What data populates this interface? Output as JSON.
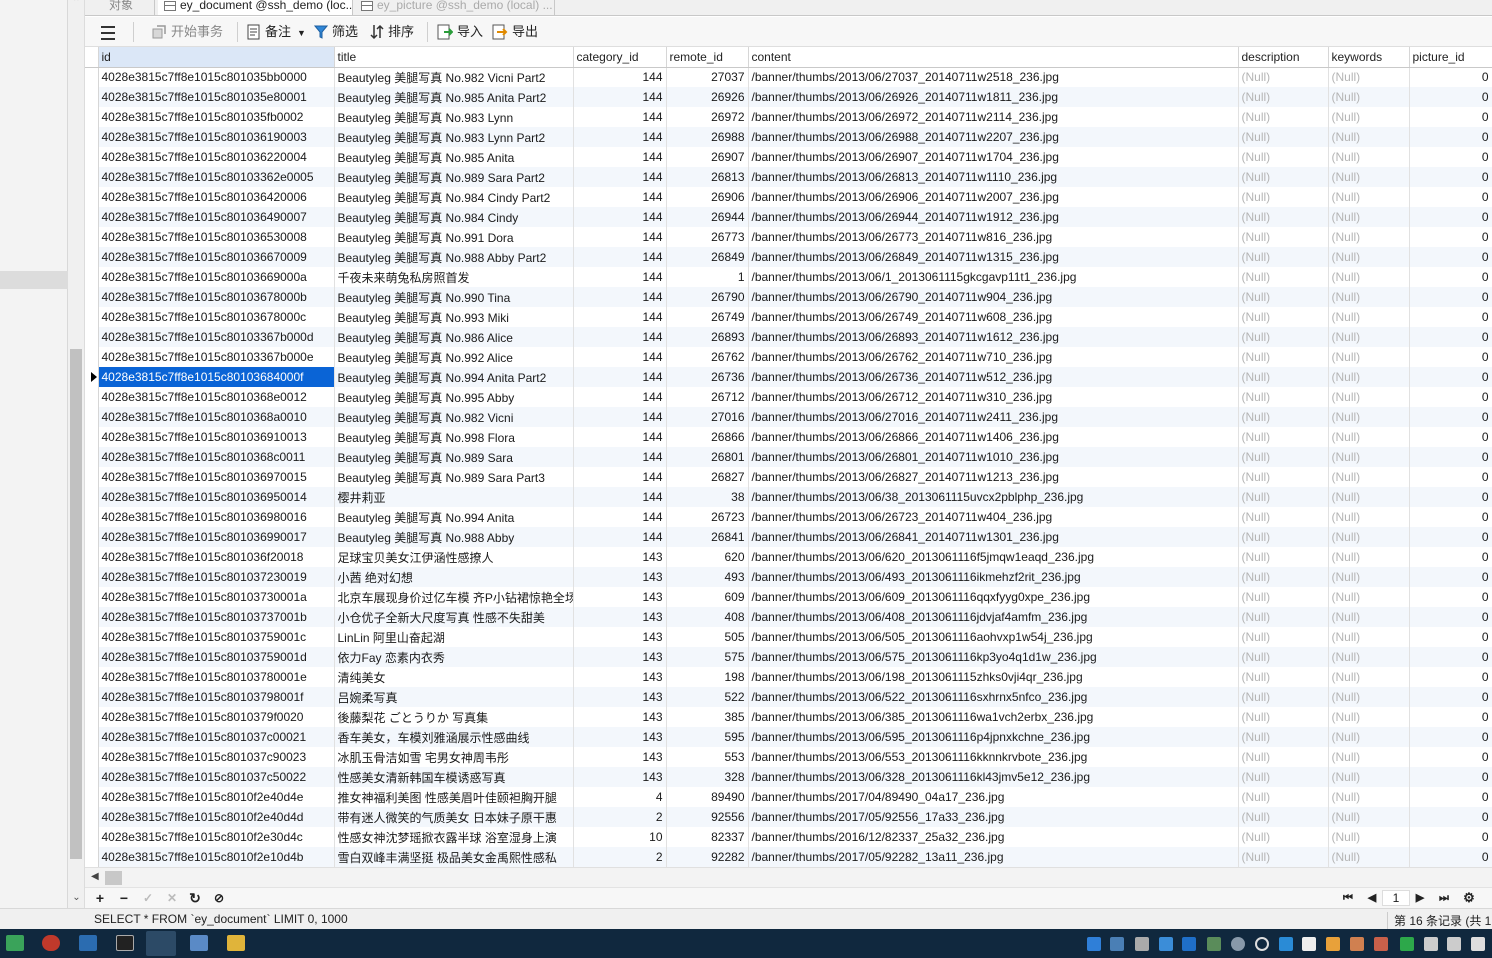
{
  "tabs": [
    {
      "label": "对象"
    },
    {
      "label": "ey_document @ssh_demo (loc..."
    },
    {
      "label": "ey_picture @ssh_demo (local) ..."
    }
  ],
  "toolbar": {
    "begin_transaction": "开始事务",
    "note": "备注",
    "filter": "筛选",
    "sort": "排序",
    "import": "导入",
    "export": "导出"
  },
  "columns": [
    "id",
    "title",
    "category_id",
    "remote_id",
    "content",
    "description",
    "keywords",
    "picture_id"
  ],
  "null_text": "(Null)",
  "current_row_index": 15,
  "rows": [
    {
      "id": "4028e3815c7ff8e1015c801035bb0000",
      "title": "Beautyleg 美腿写真 No.982 Vicni Part2",
      "category_id": "144",
      "remote_id": "27037",
      "content": "/banner/thumbs/2013/06/27037_20140711w2518_236.jpg",
      "picture_id": "0"
    },
    {
      "id": "4028e3815c7ff8e1015c801035e80001",
      "title": "Beautyleg 美腿写真 No.985 Anita Part2",
      "category_id": "144",
      "remote_id": "26926",
      "content": "/banner/thumbs/2013/06/26926_20140711w1811_236.jpg",
      "picture_id": "0"
    },
    {
      "id": "4028e3815c7ff8e1015c801035fb0002",
      "title": "Beautyleg 美腿写真 No.983 Lynn",
      "category_id": "144",
      "remote_id": "26972",
      "content": "/banner/thumbs/2013/06/26972_20140711w2114_236.jpg",
      "picture_id": "0"
    },
    {
      "id": "4028e3815c7ff8e1015c801036190003",
      "title": "Beautyleg 美腿写真 No.983 Lynn Part2",
      "category_id": "144",
      "remote_id": "26988",
      "content": "/banner/thumbs/2013/06/26988_20140711w2207_236.jpg",
      "picture_id": "0"
    },
    {
      "id": "4028e3815c7ff8e1015c801036220004",
      "title": "Beautyleg 美腿写真 No.985 Anita",
      "category_id": "144",
      "remote_id": "26907",
      "content": "/banner/thumbs/2013/06/26907_20140711w1704_236.jpg",
      "picture_id": "0"
    },
    {
      "id": "4028e3815c7ff8e1015c80103362e0005",
      "title": "Beautyleg 美腿写真 No.989 Sara Part2",
      "category_id": "144",
      "remote_id": "26813",
      "content": "/banner/thumbs/2013/06/26813_20140711w1110_236.jpg",
      "picture_id": "0"
    },
    {
      "id": "4028e3815c7ff8e1015c801036420006",
      "title": "Beautyleg 美腿写真 No.984 Cindy Part2",
      "category_id": "144",
      "remote_id": "26906",
      "content": "/banner/thumbs/2013/06/26906_20140711w2007_236.jpg",
      "picture_id": "0"
    },
    {
      "id": "4028e3815c7ff8e1015c801036490007",
      "title": "Beautyleg 美腿写真 No.984 Cindy",
      "category_id": "144",
      "remote_id": "26944",
      "content": "/banner/thumbs/2013/06/26944_20140711w1912_236.jpg",
      "picture_id": "0"
    },
    {
      "id": "4028e3815c7ff8e1015c801036530008",
      "title": "Beautyleg 美腿写真 No.991 Dora",
      "category_id": "144",
      "remote_id": "26773",
      "content": "/banner/thumbs/2013/06/26773_20140711w816_236.jpg",
      "picture_id": "0"
    },
    {
      "id": "4028e3815c7ff8e1015c801036670009",
      "title": "Beautyleg 美腿写真 No.988 Abby Part2",
      "category_id": "144",
      "remote_id": "26849",
      "content": "/banner/thumbs/2013/06/26849_20140711w1315_236.jpg",
      "picture_id": "0"
    },
    {
      "id": "4028e3815c7ff8e1015c80103669000a",
      "title": "千夜未来萌兔私房照首发",
      "category_id": "144",
      "remote_id": "1",
      "content": "/banner/thumbs/2013/06/1_2013061115gkcgavp11t1_236.jpg",
      "picture_id": "0"
    },
    {
      "id": "4028e3815c7ff8e1015c80103678000b",
      "title": "Beautyleg 美腿写真 No.990 Tina",
      "category_id": "144",
      "remote_id": "26790",
      "content": "/banner/thumbs/2013/06/26790_20140711w904_236.jpg",
      "picture_id": "0"
    },
    {
      "id": "4028e3815c7ff8e1015c80103678000c",
      "title": "Beautyleg 美腿写真 No.993 Miki",
      "category_id": "144",
      "remote_id": "26749",
      "content": "/banner/thumbs/2013/06/26749_20140711w608_236.jpg",
      "picture_id": "0"
    },
    {
      "id": "4028e3815c7ff8e1015c80103367b000d",
      "title": "Beautyleg 美腿写真 No.986 Alice",
      "category_id": "144",
      "remote_id": "26893",
      "content": "/banner/thumbs/2013/06/26893_20140711w1612_236.jpg",
      "picture_id": "0"
    },
    {
      "id": "4028e3815c7ff8e1015c80103367b000e",
      "title": "Beautyleg 美腿写真 No.992 Alice",
      "category_id": "144",
      "remote_id": "26762",
      "content": "/banner/thumbs/2013/06/26762_20140711w710_236.jpg",
      "picture_id": "0"
    },
    {
      "id": "4028e3815c7ff8e1015c80103684000f",
      "title": "Beautyleg 美腿写真 No.994 Anita Part2",
      "category_id": "144",
      "remote_id": "26736",
      "content": "/banner/thumbs/2013/06/26736_20140711w512_236.jpg",
      "picture_id": "0"
    },
    {
      "id": "4028e3815c7ff8e1015c8010368e0012",
      "title": "Beautyleg 美腿写真 No.995 Abby",
      "category_id": "144",
      "remote_id": "26712",
      "content": "/banner/thumbs/2013/06/26712_20140711w310_236.jpg",
      "picture_id": "0"
    },
    {
      "id": "4028e3815c7ff8e1015c8010368a0010",
      "title": "Beautyleg 美腿写真 No.982 Vicni",
      "category_id": "144",
      "remote_id": "27016",
      "content": "/banner/thumbs/2013/06/27016_20140711w2411_236.jpg",
      "picture_id": "0"
    },
    {
      "id": "4028e3815c7ff8e1015c801036910013",
      "title": "Beautyleg 美腿写真 No.998 Flora",
      "category_id": "144",
      "remote_id": "26866",
      "content": "/banner/thumbs/2013/06/26866_20140711w1406_236.jpg",
      "picture_id": "0"
    },
    {
      "id": "4028e3815c7ff8e1015c8010368c0011",
      "title": "Beautyleg 美腿写真 No.989 Sara",
      "category_id": "144",
      "remote_id": "26801",
      "content": "/banner/thumbs/2013/06/26801_20140711w1010_236.jpg",
      "picture_id": "0"
    },
    {
      "id": "4028e3815c7ff8e1015c801036970015",
      "title": "Beautyleg 美腿写真 No.989 Sara Part3",
      "category_id": "144",
      "remote_id": "26827",
      "content": "/banner/thumbs/2013/06/26827_20140711w1213_236.jpg",
      "picture_id": "0"
    },
    {
      "id": "4028e3815c7ff8e1015c801036950014",
      "title": "樱井莉亚",
      "category_id": "144",
      "remote_id": "38",
      "content": "/banner/thumbs/2013/06/38_2013061115uvcx2pblphp_236.jpg",
      "picture_id": "0"
    },
    {
      "id": "4028e3815c7ff8e1015c801036980016",
      "title": "Beautyleg 美腿写真 No.994 Anita",
      "category_id": "144",
      "remote_id": "26723",
      "content": "/banner/thumbs/2013/06/26723_20140711w404_236.jpg",
      "picture_id": "0"
    },
    {
      "id": "4028e3815c7ff8e1015c801036990017",
      "title": "Beautyleg 美腿写真 No.988 Abby",
      "category_id": "144",
      "remote_id": "26841",
      "content": "/banner/thumbs/2013/06/26841_20140711w1301_236.jpg",
      "picture_id": "0"
    },
    {
      "id": "4028e3815c7ff8e1015c801036f20018",
      "title": "足球宝贝美女江伊涵性感撩人",
      "category_id": "143",
      "remote_id": "620",
      "content": "/banner/thumbs/2013/06/620_2013061116f5jmqw1eaqd_236.jpg",
      "picture_id": "0"
    },
    {
      "id": "4028e3815c7ff8e1015c801037230019",
      "title": "小茜 绝对幻想",
      "category_id": "143",
      "remote_id": "493",
      "content": "/banner/thumbs/2013/06/493_2013061116ikmehzf2rit_236.jpg",
      "picture_id": "0"
    },
    {
      "id": "4028e3815c7ff8e1015c80103730001a",
      "title": "北京车展现身价过亿车模 齐P小钻裙惊艳全场",
      "category_id": "143",
      "remote_id": "609",
      "content": "/banner/thumbs/2013/06/609_2013061116qqxfyyg0xpe_236.jpg",
      "picture_id": "0"
    },
    {
      "id": "4028e3815c7ff8e1015c80103737001b",
      "title": "小仓优子全新大尺度写真 性感不失甜美",
      "category_id": "143",
      "remote_id": "408",
      "content": "/banner/thumbs/2013/06/408_2013061116jdvjaf4amfm_236.jpg",
      "picture_id": "0"
    },
    {
      "id": "4028e3815c7ff8e1015c80103759001c",
      "title": "LinLin 阿里山奋起湖",
      "category_id": "143",
      "remote_id": "505",
      "content": "/banner/thumbs/2013/06/505_2013061116aohvxp1w54j_236.jpg",
      "picture_id": "0"
    },
    {
      "id": "4028e3815c7ff8e1015c80103759001d",
      "title": "依力Fay 恋素内衣秀",
      "category_id": "143",
      "remote_id": "575",
      "content": "/banner/thumbs/2013/06/575_2013061116kp3yo4q1d1w_236.jpg",
      "picture_id": "0"
    },
    {
      "id": "4028e3815c7ff8e1015c80103780001e",
      "title": "清纯美女",
      "category_id": "143",
      "remote_id": "198",
      "content": "/banner/thumbs/2013/06/198_2013061115zhks0vji4qr_236.jpg",
      "picture_id": "0"
    },
    {
      "id": "4028e3815c7ff8e1015c80103798001f",
      "title": "吕婉柔写真",
      "category_id": "143",
      "remote_id": "522",
      "content": "/banner/thumbs/2013/06/522_2013061116sxhrnx5nfco_236.jpg",
      "picture_id": "0"
    },
    {
      "id": "4028e3815c7ff8e1015c8010379f0020",
      "title": "後藤梨花 ごとうりか 写真集",
      "category_id": "143",
      "remote_id": "385",
      "content": "/banner/thumbs/2013/06/385_2013061116wa1vch2erbx_236.jpg",
      "picture_id": "0"
    },
    {
      "id": "4028e3815c7ff8e1015c801037c00021",
      "title": "香车美女，车模刘雅涵展示性感曲线",
      "category_id": "143",
      "remote_id": "595",
      "content": "/banner/thumbs/2013/06/595_2013061116p4jpnxkchne_236.jpg",
      "picture_id": "0"
    },
    {
      "id": "4028e3815c7ff8e1015c801037c90023",
      "title": "冰肌玉骨洁如雪 宅男女神周韦彤",
      "category_id": "143",
      "remote_id": "553",
      "content": "/banner/thumbs/2013/06/553_2013061116kknnkrvbote_236.jpg",
      "picture_id": "0"
    },
    {
      "id": "4028e3815c7ff8e1015c801037c50022",
      "title": "性感美女清新韩国车模诱惑写真",
      "category_id": "143",
      "remote_id": "328",
      "content": "/banner/thumbs/2013/06/328_2013061116kl43jmv5e12_236.jpg",
      "picture_id": "0"
    },
    {
      "id": "4028e3815c7ff8e1015c8010f2e40d4e",
      "title": "推女神福利美图 性感美眉叶佳颐袒胸开腿",
      "category_id": "4",
      "remote_id": "89490",
      "content": "/banner/thumbs/2017/04/89490_04a17_236.jpg",
      "picture_id": "0"
    },
    {
      "id": "4028e3815c7ff8e1015c8010f2e40d4d",
      "title": "带有迷人微笑的气质美女 日本妹子原干惠",
      "category_id": "2",
      "remote_id": "92556",
      "content": "/banner/thumbs/2017/05/92556_17a33_236.jpg",
      "picture_id": "0"
    },
    {
      "id": "4028e3815c7ff8e1015c8010f2e30d4c",
      "title": "性感女神沈梦瑶掀衣露半球 浴室湿身上演",
      "category_id": "10",
      "remote_id": "82337",
      "content": "/banner/thumbs/2016/12/82337_25a32_236.jpg",
      "picture_id": "0"
    },
    {
      "id": "4028e3815c7ff8e1015c8010f2e10d4b",
      "title": "雪白双峰丰满坚挺 极品美女金禹熙性感私",
      "category_id": "2",
      "remote_id": "92282",
      "content": "/banner/thumbs/2017/05/92282_13a11_236.jpg",
      "picture_id": "0"
    }
  ],
  "navigation": {
    "page": "1"
  },
  "status": {
    "sql": "SELECT * FROM `ey_document` LIMIT 0, 1000",
    "record_info": "第 16 条记录 (共 1"
  }
}
